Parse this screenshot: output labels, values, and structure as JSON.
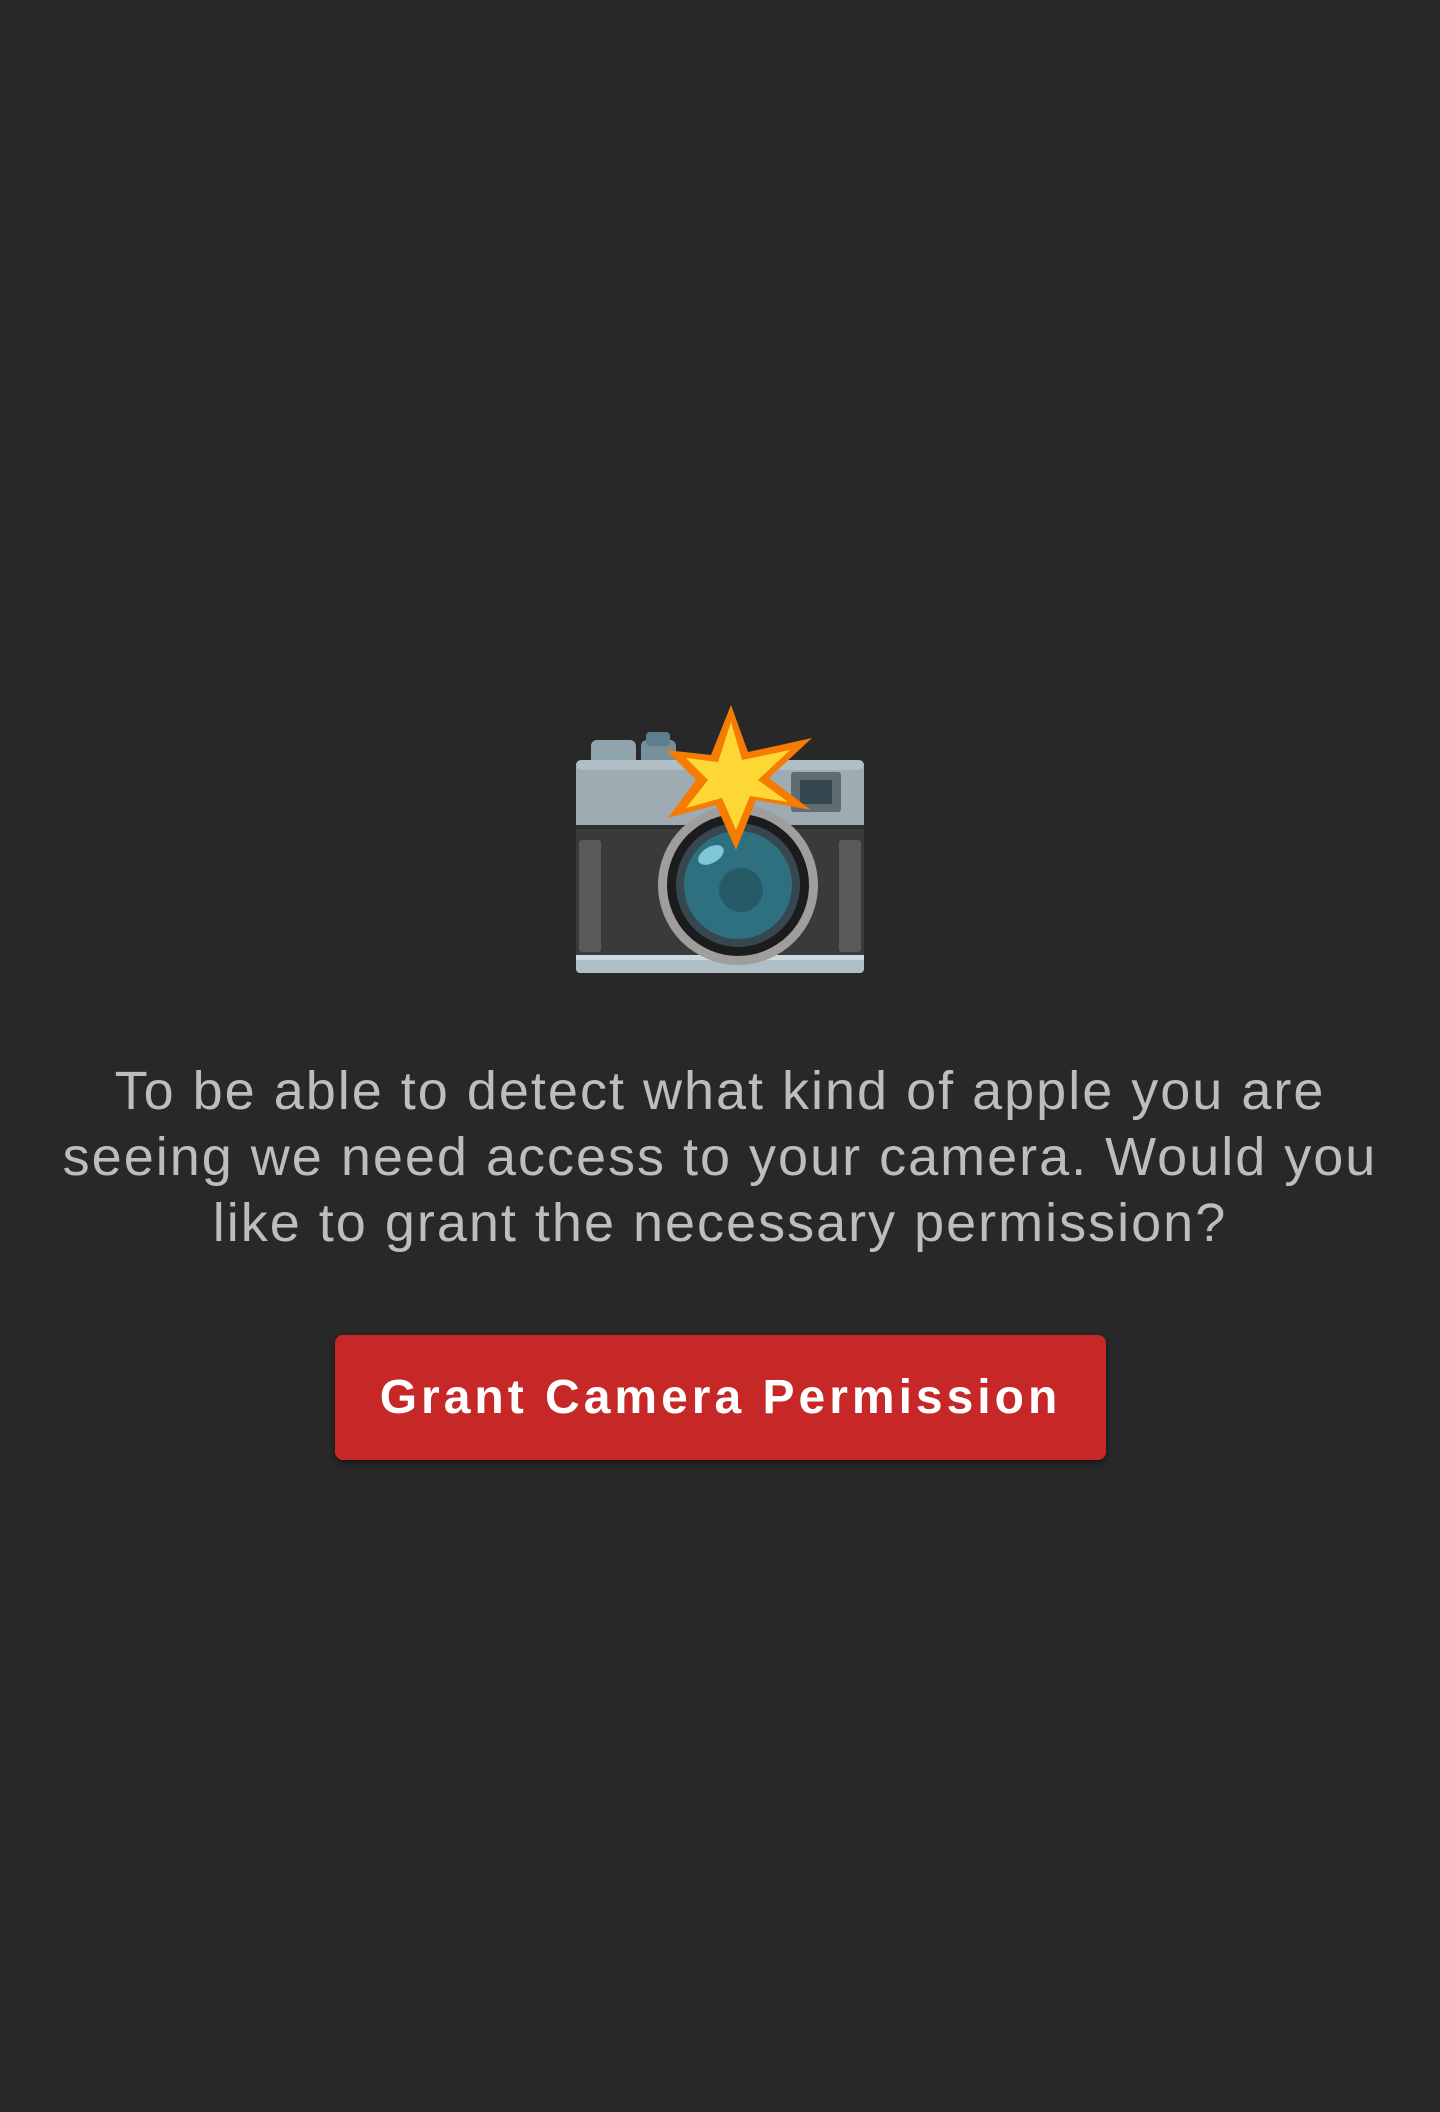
{
  "permission_screen": {
    "icon": "camera-with-flash-icon",
    "message": "To be able to detect what kind of apple you are seeing we need access to your camera. Would you like to grant the necessary permission?",
    "button_label": "Grant Camera Permission"
  },
  "colors": {
    "background": "#282828",
    "message_text": "#bdbdbd",
    "button": "#c62828",
    "button_text": "#ffffff"
  }
}
